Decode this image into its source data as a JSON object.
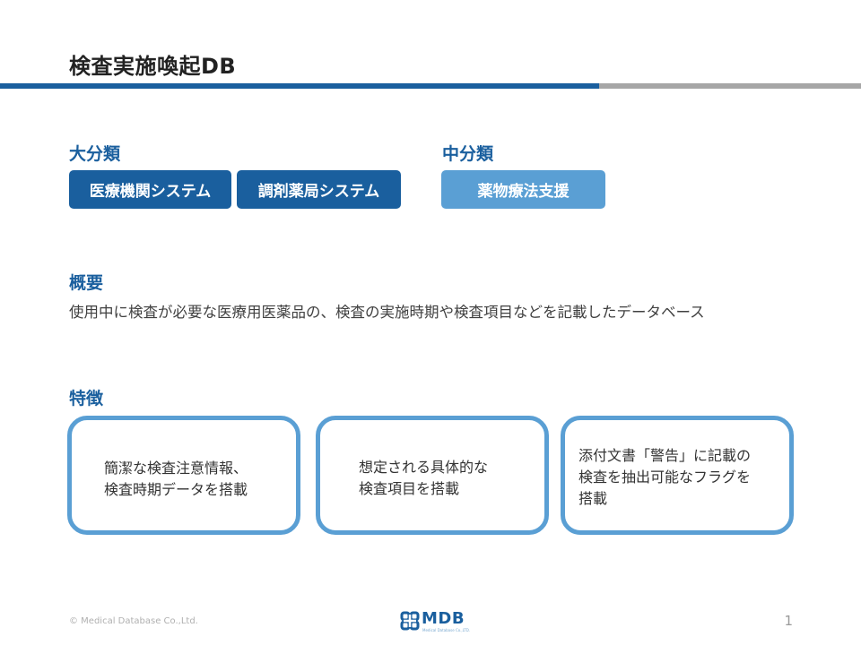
{
  "slide": {
    "title": "検査実施喚起DB",
    "colors": {
      "primary": "#1a5f9e",
      "accent_light": "#5a9fd4",
      "divider_gray": "#a6a6a6"
    }
  },
  "classification": {
    "major_heading": "大分類",
    "major_tags": [
      "医療機関システム",
      "調剤薬局システム"
    ],
    "minor_heading": "中分類",
    "minor_tags": [
      "薬物療法支援"
    ]
  },
  "overview": {
    "heading": "概要",
    "text": "使用中に検査が必要な医療用医薬品の、検査の実施時期や検査項目などを記載したデータベース"
  },
  "features": {
    "heading": "特徴",
    "cards": [
      {
        "lines": [
          "簡潔な検査注意情報、",
          "検査時期データを搭載"
        ]
      },
      {
        "lines": [
          "想定される具体的な",
          "検査項目を搭載"
        ]
      },
      {
        "lines": [
          "添付文書「警告」に記載の",
          "検査を抽出可能なフラグを",
          "搭載"
        ]
      }
    ]
  },
  "footer": {
    "copyright": "© Medical Database Co.,Ltd.",
    "logo_text": "MDB",
    "logo_subtext": "Medical Database Co.,LTD.",
    "logo_icon": "mdb-cross-logo-icon",
    "page_number": "1"
  }
}
